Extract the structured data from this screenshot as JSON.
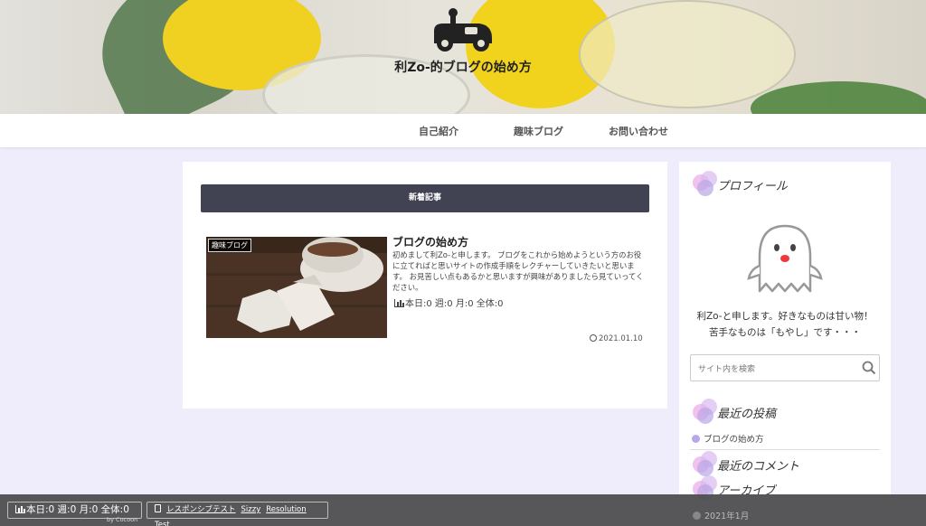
{
  "header": {
    "site_title": "利Zo-的ブログの始め方"
  },
  "nav": {
    "items": [
      "自己紹介",
      "趣味ブログ",
      "お問い合わせ"
    ]
  },
  "main": {
    "section_title": "新着記事",
    "post": {
      "category": "趣味ブログ",
      "title": "ブログの始め方",
      "excerpt": "初めまして利Zo-と申します。 ブログをこれから始めようという方のお役に立てればと思いサイトの作成手順をレクチャーしていきたいと思います。 お見苦しい点もあるかと思いますが興味がありましたら見ていってください。",
      "views": "本日:0 週:0 月:0 全体:0",
      "date": "2021.01.10"
    }
  },
  "sidebar": {
    "profile_title": "プロフィール",
    "profile_line1": "利Zo-と申します。好きなものは甘い物！",
    "profile_line2": "苦手なものは「もやし」です・・・",
    "search_placeholder": "サイト内を検索",
    "recent_title": "最近の投稿",
    "recent_posts": [
      "ブログの始め方"
    ],
    "comments_title": "最近のコメント",
    "archive_title": "アーカイブ",
    "archive_item": "2021年1月"
  },
  "bottom_bar": {
    "counter": "本日:0 週:0 月:0 全体:0",
    "by": "by Cocoon",
    "links": [
      "レスポンシブテスト",
      "Sizzy",
      "Resolution Test"
    ]
  },
  "colors": {
    "accent_pink": "#e9a8e6",
    "accent_purple": "#b9a7e6",
    "nav_bar_dark": "#414252"
  }
}
